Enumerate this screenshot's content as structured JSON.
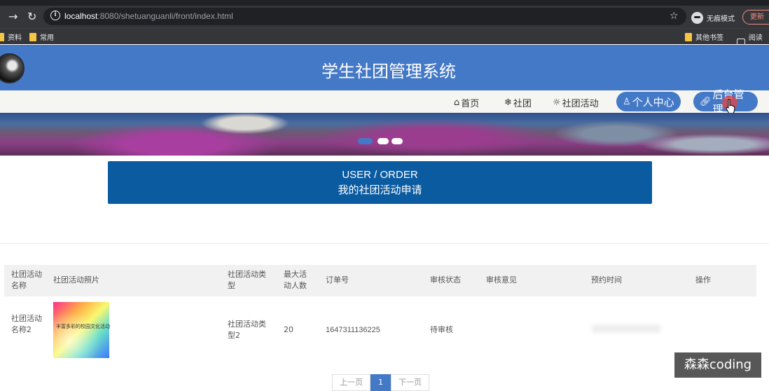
{
  "browser": {
    "url_host": "localhost",
    "url_rest": ":8080/shetuanguanli/front/index.html",
    "incognito_label": "无痕模式",
    "update_label": "更新",
    "bookmarks": [
      "资料",
      "常用"
    ],
    "bookmarks_right": [
      "其他书签",
      "阅读清"
    ]
  },
  "header": {
    "title": "学生社团管理系统"
  },
  "nav": {
    "home": "首页",
    "clubs": "社团",
    "activities": "社团活动",
    "personal_center": "个人中心",
    "admin": "后台管理"
  },
  "section": {
    "title_en": "USER / ORDER",
    "title_cn": "我的社团活动申请"
  },
  "table": {
    "headers": [
      "社团活动名称",
      "社团活动照片",
      "社团活动类型",
      "最大活动人数",
      "订单号",
      "审核状态",
      "审核意见",
      "预约时间",
      "操作"
    ],
    "rows": [
      {
        "name": "社团活动名称2",
        "photo_caption": "丰富多彩的校园文化活动",
        "type": "社团活动类型2",
        "max_people": "20",
        "order_no": "1647311136225",
        "status": "待审核",
        "opinion": "",
        "time": ""
      }
    ]
  },
  "pagination": {
    "prev": "上一页",
    "current": "1",
    "next": "下一页"
  },
  "watermark": "森森coding"
}
